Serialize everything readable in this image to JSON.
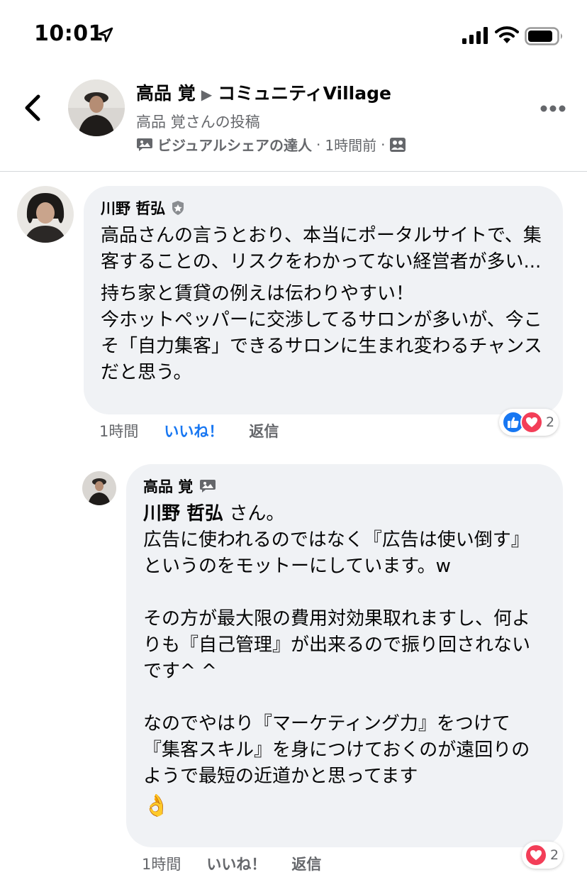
{
  "status_bar": {
    "time": "10:01"
  },
  "post_header": {
    "author": "高品 覚",
    "group": "コミュニティVillage",
    "subtitle": "高品 覚さんの投稿",
    "badge": "ビジュアルシェアの達人",
    "dot": "·",
    "time": "1時間前",
    "dot2": "·"
  },
  "comments": [
    {
      "author": "川野 哲弘",
      "paragraphs": [
        "高品さんの言うとおり、本当にポータルサイトで、集客することの、リスクをわかってない経営者が多い...",
        "持ち家と賃貸の例えは伝わりやすい！\n今ホットペッパーに交渉してるサロンが多いが、今こそ「自力集客」できるサロンに生まれ変わるチャンスだと思う。"
      ],
      "time": "1時間",
      "like_label": "いいね！",
      "reply_label": "返信",
      "reaction_count": "2"
    },
    {
      "author": "高品 覚",
      "mention": "川野 哲弘",
      "mention_suffix": " さん。",
      "paragraphs": [
        "広告に使われるのではなく『広告は使い倒す』というのをモットーにしています。w",
        "その方が最大限の費用対効果取れますし、何よりも『自己管理』が出来るので振り回されないです^ ^",
        "なのでやはり『マーケティング力』をつけて『集客スキル』を身につけておくのが遠回りのようで最短の近道かと思ってます"
      ],
      "emoji": "👌",
      "time": "1時間",
      "like_label": "いいね！",
      "reply_label": "返信",
      "reaction_count": "2"
    }
  ],
  "colors": {
    "accent": "#1877f2",
    "bubble": "#f0f2f5",
    "secondary_text": "#65676b",
    "love": "#f33e58"
  }
}
